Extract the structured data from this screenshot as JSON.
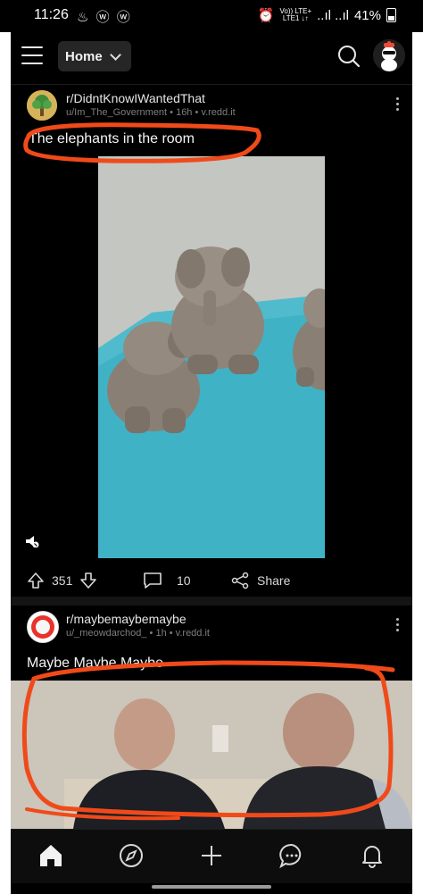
{
  "status_bar": {
    "time": "11:26",
    "left_icons": "♨ ⓦ ⓦ",
    "network_top": "Vo))  LTE+",
    "network_bottom": "LTE1 ↓↑",
    "signal": "..ıl ..ıl",
    "battery": "41%"
  },
  "app_bar": {
    "feed_label": "Home",
    "icons": [
      "menu-icon",
      "chevron-down-icon",
      "search-icon",
      "avatar"
    ]
  },
  "posts": [
    {
      "subreddit": "r/DidntKnowIWantedThat",
      "meta": "u/Im_The_Government • 16h • v.redd.it",
      "title": "The elephants in the room",
      "upvotes": "351",
      "comments": "10",
      "share_label": "Share"
    },
    {
      "subreddit": "r/maybemaybemaybe",
      "meta": "u/_meowdarchod_ • 1h • v.redd.it",
      "title": "Maybe Maybe Maybe"
    }
  ],
  "bottom_nav": [
    "home-icon",
    "explore-icon",
    "create-icon",
    "chat-icon",
    "notifications-icon"
  ],
  "colors": {
    "background": "#000000",
    "annotation_red": "#f04a1a",
    "video_wall": "#c4c6c2",
    "video_table": "#3fb2c6"
  }
}
